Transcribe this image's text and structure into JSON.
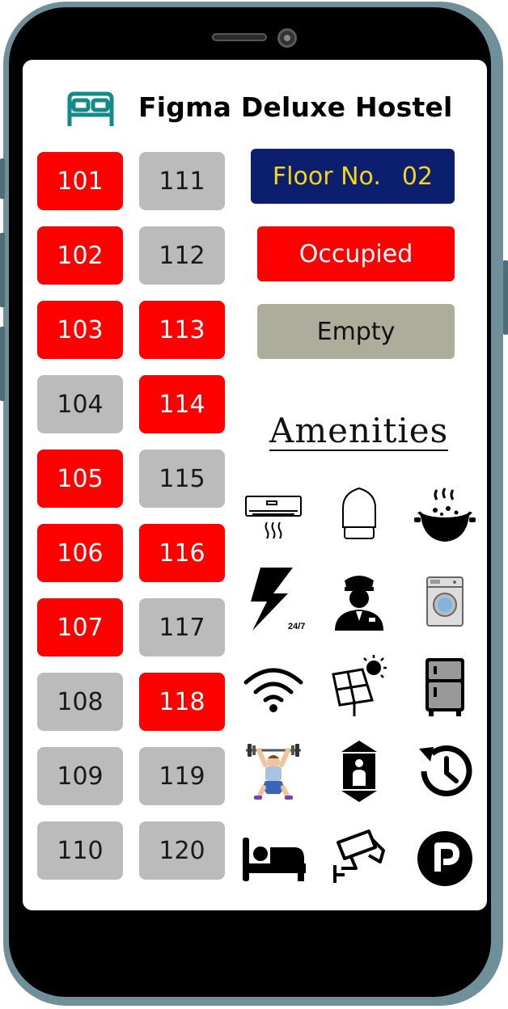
{
  "header": {
    "title": "Figma Deluxe Hostel",
    "logo_icon": "bed-icon",
    "logo_color": "#138a8a"
  },
  "floor": {
    "label": "Floor No.",
    "number": "02"
  },
  "legend": {
    "occupied": "Occupied",
    "empty": "Empty"
  },
  "colors": {
    "occupied": "#ff0000",
    "empty": "#bbbbbb",
    "floor_badge": "#0c1f6e",
    "floor_text": "#f4d51c"
  },
  "rooms": [
    {
      "number": "101",
      "status": "occupied"
    },
    {
      "number": "102",
      "status": "occupied"
    },
    {
      "number": "103",
      "status": "occupied"
    },
    {
      "number": "104",
      "status": "empty"
    },
    {
      "number": "105",
      "status": "occupied"
    },
    {
      "number": "106",
      "status": "occupied"
    },
    {
      "number": "107",
      "status": "occupied"
    },
    {
      "number": "108",
      "status": "empty"
    },
    {
      "number": "109",
      "status": "empty"
    },
    {
      "number": "110",
      "status": "empty"
    },
    {
      "number": "111",
      "status": "empty"
    },
    {
      "number": "112",
      "status": "empty"
    },
    {
      "number": "113",
      "status": "occupied"
    },
    {
      "number": "114",
      "status": "occupied"
    },
    {
      "number": "115",
      "status": "empty"
    },
    {
      "number": "116",
      "status": "occupied"
    },
    {
      "number": "117",
      "status": "empty"
    },
    {
      "number": "118",
      "status": "occupied"
    },
    {
      "number": "119",
      "status": "empty"
    },
    {
      "number": "120",
      "status": "empty"
    }
  ],
  "amenities": {
    "title": "Amenities",
    "items": [
      {
        "icon": "air-conditioner-icon"
      },
      {
        "icon": "iron-icon"
      },
      {
        "icon": "food-pot-icon"
      },
      {
        "icon": "power-24-7-icon",
        "badge": "24/7"
      },
      {
        "icon": "security-guard-icon"
      },
      {
        "icon": "washing-machine-icon"
      },
      {
        "icon": "wifi-icon"
      },
      {
        "icon": "solar-panel-icon"
      },
      {
        "icon": "refrigerator-icon"
      },
      {
        "icon": "gym-weightlifter-icon"
      },
      {
        "icon": "elevator-icon"
      },
      {
        "icon": "24-hour-service-icon"
      },
      {
        "icon": "bed-icon"
      },
      {
        "icon": "cctv-camera-icon"
      },
      {
        "icon": "parking-icon"
      }
    ]
  }
}
